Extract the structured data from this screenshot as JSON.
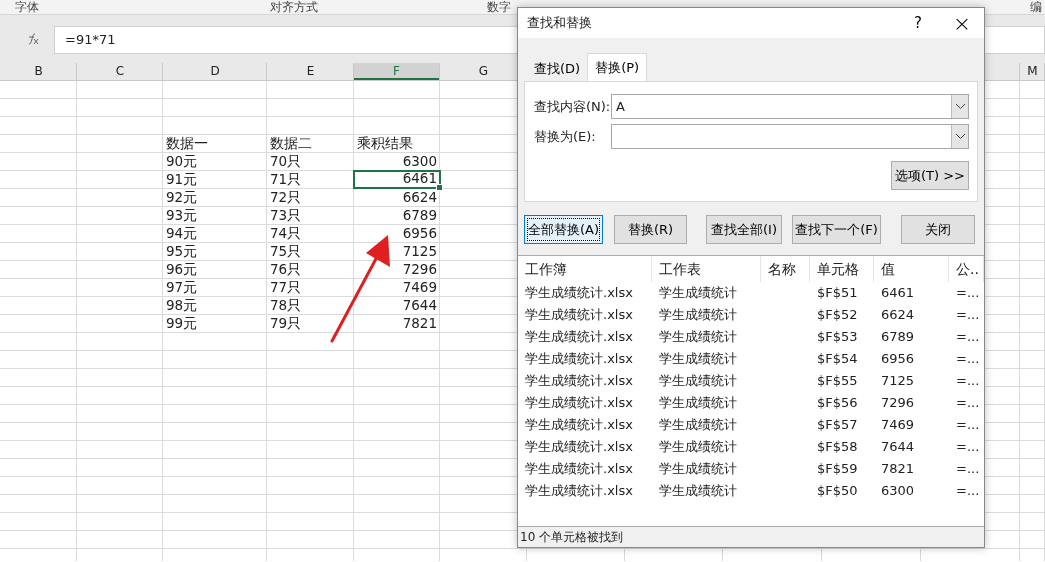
{
  "ribbon_groups": [
    "字体",
    "对齐方式",
    "数字",
    "编"
  ],
  "formula_bar": {
    "formula": "=91*71"
  },
  "columns": [
    {
      "label": "B",
      "selected": false
    },
    {
      "label": "C",
      "selected": false
    },
    {
      "label": "D",
      "selected": false
    },
    {
      "label": "E",
      "selected": false
    },
    {
      "label": "F",
      "selected": true
    },
    {
      "label": "G",
      "selected": false
    },
    {
      "label": "M",
      "selected": false
    }
  ],
  "sheet": {
    "header": [
      "数据一",
      "数据二",
      "乘积结果"
    ],
    "rows": [
      {
        "data_1": "90元",
        "data_2": "70只",
        "result": "6300",
        "selected": false
      },
      {
        "data_1": "91元",
        "data_2": "71只",
        "result": "6461",
        "selected": true
      },
      {
        "data_1": "92元",
        "data_2": "72只",
        "result": "6624",
        "selected": false
      },
      {
        "data_1": "93元",
        "data_2": "73只",
        "result": "6789",
        "selected": false
      },
      {
        "data_1": "94元",
        "data_2": "74只",
        "result": "6956",
        "selected": false
      },
      {
        "data_1": "95元",
        "data_2": "75只",
        "result": "7125",
        "selected": false
      },
      {
        "data_1": "96元",
        "data_2": "76只",
        "result": "7296",
        "selected": false
      },
      {
        "data_1": "97元",
        "data_2": "77只",
        "result": "7469",
        "selected": false
      },
      {
        "data_1": "98元",
        "data_2": "78只",
        "result": "7644",
        "selected": false
      },
      {
        "data_1": "99元",
        "data_2": "79只",
        "result": "7821",
        "selected": false
      }
    ]
  },
  "dialog": {
    "title": "查找和替换",
    "help": "?",
    "close": "×",
    "tabs": [
      {
        "label": "查找(D)",
        "selected": false
      },
      {
        "label": "替换(P)",
        "selected": true
      }
    ],
    "fields": [
      {
        "label": "查找内容(N):",
        "value": "A"
      },
      {
        "label": "替换为(E):"
      }
    ],
    "options_button": "选项(T) >>",
    "buttons": [
      {
        "label": "全部替换(A)",
        "focused": true
      },
      {
        "label": "替换(R)",
        "focused": false
      },
      {
        "label": "查找全部(I)",
        "focused": false
      },
      {
        "label": "查找下一个(F)",
        "focused": false
      },
      {
        "label": "关闭",
        "focused": false
      }
    ],
    "results": {
      "columns": [
        "工作簿",
        "工作表",
        "名称",
        "单元格",
        "值",
        "公.."
      ],
      "rows": [
        {
          "workbook": "学生成绩统计.xlsx",
          "sheet": "学生成绩统计",
          "cell": "$F$51",
          "value": "6461",
          "formula": "=..."
        },
        {
          "workbook": "学生成绩统计.xlsx",
          "sheet": "学生成绩统计",
          "cell": "$F$52",
          "value": "6624",
          "formula": "=..."
        },
        {
          "workbook": "学生成绩统计.xlsx",
          "sheet": "学生成绩统计",
          "cell": "$F$53",
          "value": "6789",
          "formula": "=..."
        },
        {
          "workbook": "学生成绩统计.xlsx",
          "sheet": "学生成绩统计",
          "cell": "$F$54",
          "value": "6956",
          "formula": "=..."
        },
        {
          "workbook": "学生成绩统计.xlsx",
          "sheet": "学生成绩统计",
          "cell": "$F$55",
          "value": "7125",
          "formula": "=..."
        },
        {
          "workbook": "学生成绩统计.xlsx",
          "sheet": "学生成绩统计",
          "cell": "$F$56",
          "value": "7296",
          "formula": "=..."
        },
        {
          "workbook": "学生成绩统计.xlsx",
          "sheet": "学生成绩统计",
          "cell": "$F$57",
          "value": "7469",
          "formula": "=..."
        },
        {
          "workbook": "学生成绩统计.xlsx",
          "sheet": "学生成绩统计",
          "cell": "$F$58",
          "value": "7644",
          "formula": "=..."
        },
        {
          "workbook": "学生成绩统计.xlsx",
          "sheet": "学生成绩统计",
          "cell": "$F$59",
          "value": "7821",
          "formula": "=..."
        },
        {
          "workbook": "学生成绩统计.xlsx",
          "sheet": "学生成绩统计",
          "cell": "$F$50",
          "value": "6300",
          "formula": "=..."
        }
      ]
    },
    "status": "10 个单元格被找到"
  }
}
